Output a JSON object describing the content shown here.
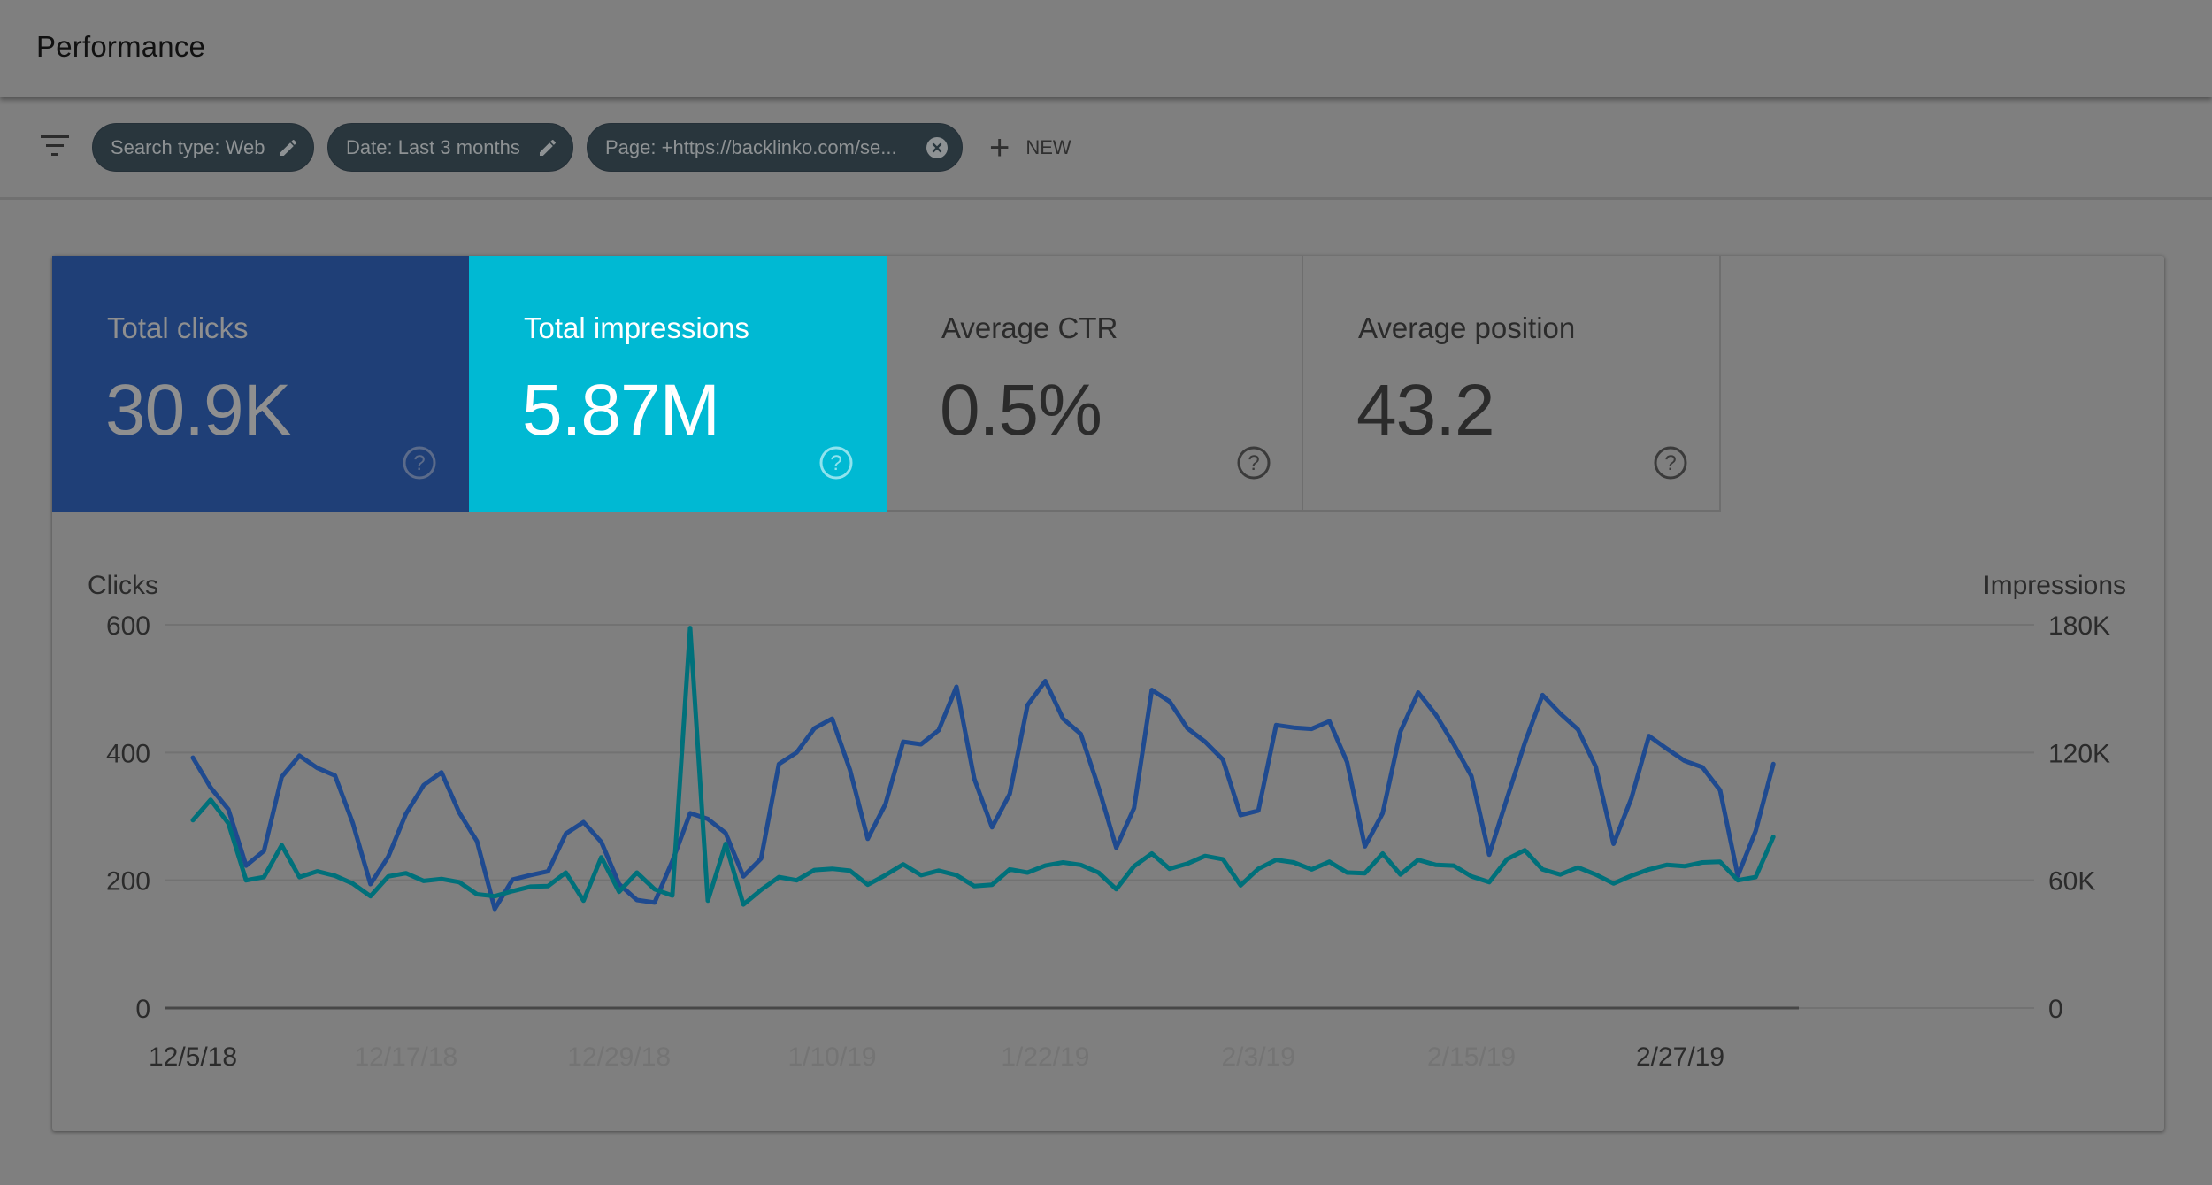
{
  "header": {
    "title": "Performance"
  },
  "filters": {
    "filter_icon": "filter-list-icon",
    "chips": [
      {
        "label": "Search type: Web",
        "icon": "pencil-icon"
      },
      {
        "label": "Date: Last 3 months",
        "icon": "pencil-icon"
      },
      {
        "label": "Page: +https://backlinko.com/se...",
        "icon": "close-circle-icon"
      }
    ],
    "new_label": "NEW",
    "new_icon": "plus-icon"
  },
  "metrics": [
    {
      "label": "Total clicks",
      "value": "30.9K",
      "selected": true,
      "color": "#1f3f77"
    },
    {
      "label": "Total impressions",
      "value": "5.87M",
      "selected": true,
      "color": "#00b9d3"
    },
    {
      "label": "Average CTR",
      "value": "0.5%",
      "selected": false
    },
    {
      "label": "Average position",
      "value": "43.2",
      "selected": false
    }
  ],
  "chart_data": {
    "type": "line",
    "title": "",
    "x_start_date": "12/5/18",
    "x_tick_labels": [
      "12/5/18",
      "12/17/18",
      "12/29/18",
      "1/10/19",
      "1/22/19",
      "2/3/19",
      "2/15/19",
      "2/27/19"
    ],
    "x_tick_emphasized": [
      "12/5/18",
      "2/27/19"
    ],
    "x_tick_interval_days": 12,
    "left_axis": {
      "label": "Clicks",
      "ticks": [
        "0",
        "200",
        "400",
        "600"
      ],
      "range": [
        0,
        600
      ]
    },
    "right_axis": {
      "label": "Impressions",
      "ticks": [
        "0",
        "60K",
        "120K",
        "180K"
      ],
      "range": [
        0,
        180000
      ]
    },
    "grid": true,
    "series": [
      {
        "name": "Clicks",
        "axis": "left",
        "color": "#1f4a8f",
        "values": [
          392,
          345,
          311,
          223,
          246,
          362,
          395,
          376,
          364,
          290,
          194,
          237,
          304,
          349,
          369,
          306,
          261,
          155,
          201,
          208,
          214,
          273,
          291,
          260,
          194,
          169,
          165,
          230,
          305,
          296,
          274,
          206,
          234,
          382,
          400,
          438,
          453,
          373,
          265,
          319,
          417,
          413,
          435,
          503,
          359,
          283,
          335,
          474,
          512,
          453,
          429,
          345,
          251,
          313,
          498,
          480,
          438,
          417,
          389,
          302,
          309,
          443,
          439,
          437,
          449,
          385,
          253,
          305,
          433,
          494,
          459,
          413,
          363,
          240,
          328,
          415,
          490,
          461,
          436,
          378,
          257,
          328,
          426,
          406,
          387,
          377,
          341,
          207,
          277,
          382
        ]
      },
      {
        "name": "Impressions",
        "axis": "right",
        "color": "#00707a",
        "values": [
          88200,
          97800,
          86700,
          60000,
          61500,
          76500,
          61500,
          64200,
          62100,
          58500,
          52500,
          61800,
          63300,
          59700,
          60600,
          59100,
          53400,
          52500,
          54900,
          57000,
          57300,
          63600,
          50400,
          70800,
          54600,
          63600,
          55800,
          52800,
          178500,
          50400,
          77100,
          48600,
          55500,
          61500,
          60000,
          64800,
          65400,
          64500,
          57900,
          62400,
          67500,
          62400,
          64500,
          62400,
          57300,
          57900,
          65100,
          63600,
          66900,
          68400,
          67200,
          63600,
          55800,
          66600,
          72600,
          65400,
          67800,
          71400,
          69900,
          57600,
          65400,
          69600,
          68400,
          65100,
          68700,
          63600,
          63300,
          72600,
          62700,
          69600,
          67200,
          66900,
          61800,
          59100,
          69900,
          74100,
          65100,
          62700,
          66000,
          62700,
          58500,
          62100,
          65100,
          67200,
          66600,
          68400,
          68700,
          60000,
          61500,
          80400
        ]
      }
    ]
  }
}
